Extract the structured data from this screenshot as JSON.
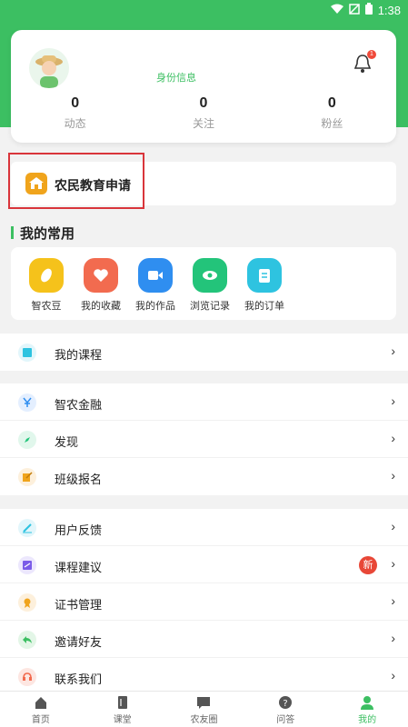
{
  "status_bar": {
    "time": "1:38"
  },
  "profile": {
    "id_info": "身份信息",
    "notification_count": "1",
    "stats": [
      {
        "value": "0",
        "label": "动态"
      },
      {
        "value": "0",
        "label": "关注"
      },
      {
        "value": "0",
        "label": "粉丝"
      }
    ]
  },
  "education": {
    "label": "农民教育申请"
  },
  "common": {
    "title": "我的常用",
    "items": [
      {
        "label": "智农豆",
        "icon": "bean-icon",
        "color": "#f5c21b"
      },
      {
        "label": "我的收藏",
        "icon": "heart-icon",
        "color": "#f26b4f"
      },
      {
        "label": "我的作品",
        "icon": "video-icon",
        "color": "#2f8ef0"
      },
      {
        "label": "浏览记录",
        "icon": "eye-icon",
        "color": "#23c47a"
      },
      {
        "label": "我的订单",
        "icon": "clipboard-icon",
        "color": "#2ec3e0"
      }
    ]
  },
  "lists": {
    "group1": [
      {
        "label": "我的课程",
        "icon": "book-icon",
        "color": "#2ec3e0"
      }
    ],
    "group2": [
      {
        "label": "智农金融",
        "icon": "yuan-icon",
        "color": "#2f8ef0"
      },
      {
        "label": "发现",
        "icon": "compass-icon",
        "color": "#23c47a"
      },
      {
        "label": "班级报名",
        "icon": "edit-icon",
        "color": "#f0a41c"
      }
    ],
    "group3": [
      {
        "label": "用户反馈",
        "icon": "pencil-icon",
        "color": "#2ec3e0"
      },
      {
        "label": "课程建议",
        "icon": "note-icon",
        "color": "#7b5ce8",
        "badge": "新"
      },
      {
        "label": "证书管理",
        "icon": "medal-icon",
        "color": "#f0a41c"
      },
      {
        "label": "邀请好友",
        "icon": "share-icon",
        "color": "#3cbf62"
      },
      {
        "label": "联系我们",
        "icon": "headset-icon",
        "color": "#f26b4f"
      }
    ]
  },
  "tabs": [
    {
      "label": "首页",
      "icon": "home-icon"
    },
    {
      "label": "课堂",
      "icon": "book-icon"
    },
    {
      "label": "农友圈",
      "icon": "chat-icon"
    },
    {
      "label": "问答",
      "icon": "question-icon"
    },
    {
      "label": "我的",
      "icon": "user-icon",
      "active": true
    }
  ],
  "arrow": "›"
}
